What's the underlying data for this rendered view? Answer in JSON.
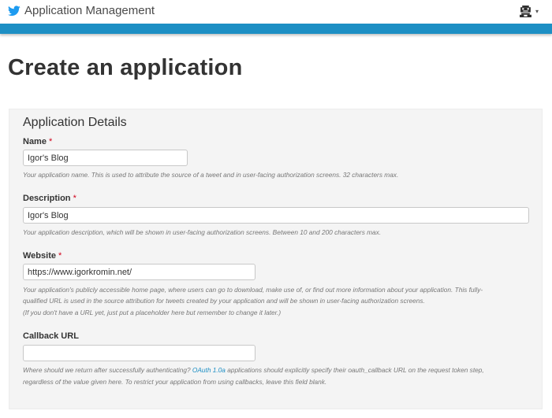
{
  "header": {
    "app_title": "Application Management",
    "logo_icon": "twitter-bird-icon",
    "avatar_icon": "user-avatar-icon",
    "menu_caret": "▾",
    "brand_color": "#1d8fc4"
  },
  "page": {
    "title": "Create an application"
  },
  "form": {
    "section_title": "Application Details",
    "required_marker": "*",
    "name": {
      "label": "Name",
      "value": "Igor's Blog",
      "help": "Your application name. This is used to attribute the source of a tweet and in user-facing authorization screens. 32 characters max."
    },
    "description": {
      "label": "Description",
      "value": "Igor's Blog",
      "help": "Your application description, which will be shown in user-facing authorization screens. Between 10 and 200 characters max."
    },
    "website": {
      "label": "Website",
      "value": "https://www.igorkromin.net/",
      "help_line1": "Your application's publicly accessible home page, where users can go to download, make use of, or find out more information about your application. This fully-",
      "help_line2": "qualified URL is used in the source attribution for tweets created by your application and will be shown in user-facing authorization screens.",
      "help_line3": "(If you don't have a URL yet, just put a placeholder here but remember to change it later.)"
    },
    "callback": {
      "label": "Callback URL",
      "value": "",
      "help_before_link": "Where should we return after successfully authenticating? ",
      "help_link": "OAuth 1.0a",
      "help_after_link": " applications should explicitly specify their oauth_callback URL on the request token step,",
      "help_line2": "regardless of the value given here. To restrict your application from using callbacks, leave this field blank."
    }
  }
}
